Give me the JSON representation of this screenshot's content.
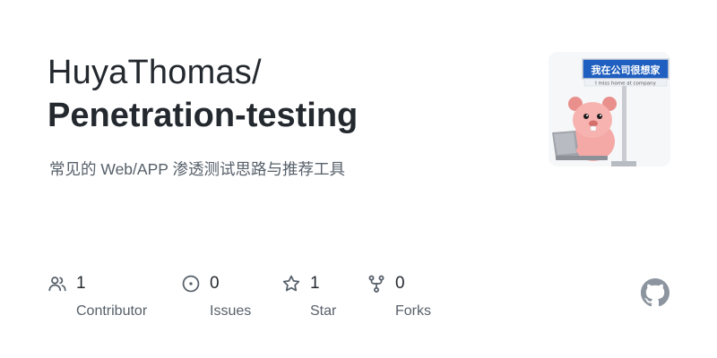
{
  "repo_card": {
    "owner": "HuyaThomas/",
    "name": "Penetration-testing",
    "description": "常见的 Web/APP 渗透测试思路与推荐工具",
    "avatar": {
      "sign_text": "我在公司很想家",
      "sign_subtext": "I miss home at company"
    }
  },
  "stats": {
    "contributors": {
      "value": "1",
      "label": "Contributor",
      "icon": "people-icon"
    },
    "issues": {
      "value": "0",
      "label": "Issues",
      "icon": "issue-opened-icon"
    },
    "stars": {
      "value": "1",
      "label": "Star",
      "icon": "star-icon"
    },
    "forks": {
      "value": "0",
      "label": "Forks",
      "icon": "repo-forked-icon"
    }
  },
  "brand": {
    "logo": "github-mark-icon",
    "logo_color": "#8c959f"
  },
  "colors": {
    "title": "#24292f",
    "muted": "#57606a",
    "icon": "#57606a"
  }
}
